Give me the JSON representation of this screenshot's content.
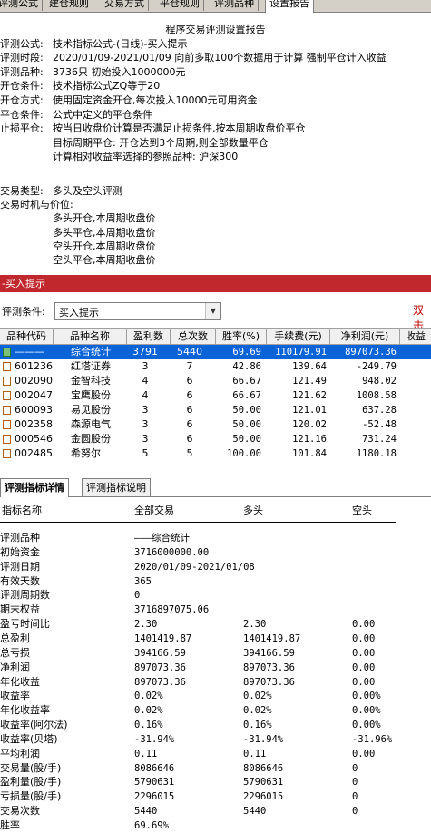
{
  "top_tabs": [
    "评测公式",
    "建仓规则",
    "交易方式",
    "平仓规则",
    "评测品种",
    "设置报告"
  ],
  "report": {
    "title": "程序交易评测设置报告",
    "lines": [
      {
        "label": "评测公式:",
        "value": "技术指标公式-(日线)-买入提示"
      },
      {
        "label": "评测时段:",
        "value": "2020/01/09-2021/01/09 向前多取100个数据用于计算 强制平仓计入收益"
      },
      {
        "label": "评测品种:",
        "value": "3736只 初始投入1000000元"
      },
      {
        "label": "开仓条件:",
        "value": "技术指标公式ZQ等于20"
      },
      {
        "label": "开仓方式:",
        "value": "使用固定资金开仓,每次投入10000元可用资金"
      },
      {
        "label": "平仓条件:",
        "value": "公式中定义的平仓条件"
      },
      {
        "label": "止损平仓:",
        "value": "按当日收盘价计算是否满足止损条件,按本周期收盘价平仓"
      },
      {
        "label": "",
        "value": "目标周期平仓: 开仓达到3个周期,则全部数量平仓"
      },
      {
        "label": "",
        "value": "计算相对收益率选择的参照品种: 沪深300"
      },
      {
        "label": "",
        "value": ""
      },
      {
        "label": "交易类型:",
        "value": "多头及空头评测"
      },
      {
        "label": "交易时机与价位:",
        "value": ""
      },
      {
        "label": "",
        "value": "多头开仓,本周期收盘价"
      },
      {
        "label": "",
        "value": "多头平仓,本周期收盘价"
      },
      {
        "label": "",
        "value": "空头开仓,本周期收盘价"
      },
      {
        "label": "",
        "value": "空头平仓,本周期收盘价"
      }
    ]
  },
  "red_bar": "-买入提示",
  "condition": {
    "label": "评测条件:",
    "value": "买入提示",
    "right_label": "双击"
  },
  "grid": {
    "headers": [
      "品种代码",
      "品种名称",
      "盈利数",
      "总次数",
      "胜率(%)",
      "手续费(元)",
      "净利润(元)",
      "收益"
    ],
    "rows": [
      [
        "———",
        "综合统计",
        "3791",
        "5440",
        "69.69",
        "110179.91",
        "897073.36"
      ],
      [
        "601236",
        "红塔证券",
        "3",
        "7",
        "42.86",
        "139.64",
        "-249.79"
      ],
      [
        "002090",
        "金智科技",
        "4",
        "6",
        "66.67",
        "121.49",
        "948.02"
      ],
      [
        "002047",
        "宝鹰股份",
        "4",
        "6",
        "66.67",
        "121.62",
        "1008.58"
      ],
      [
        "600093",
        "易见股份",
        "3",
        "6",
        "50.00",
        "121.01",
        "637.28"
      ],
      [
        "002358",
        "森源电气",
        "3",
        "6",
        "50.00",
        "120.02",
        "-52.48"
      ],
      [
        "000546",
        "金圆股份",
        "3",
        "6",
        "50.00",
        "121.16",
        "731.24"
      ],
      [
        "002485",
        "希努尔",
        "5",
        "5",
        "100.00",
        "101.84",
        "1180.18"
      ]
    ]
  },
  "mid_tabs": [
    "评测指标详情",
    "评测指标说明"
  ],
  "detail": {
    "headers": [
      "指标名称",
      "全部交易",
      "多头",
      "空头"
    ],
    "rows": [
      [
        "评测品种",
        "———综合统计",
        "",
        ""
      ],
      [
        "初始资金",
        "3716000000.00",
        "",
        ""
      ],
      [
        "评测日期",
        "2020/01/09-2021/01/08",
        "",
        ""
      ],
      [
        "有效天数",
        "365",
        "",
        ""
      ],
      [
        "评测周期数",
        "0",
        "",
        ""
      ],
      [
        "期末权益",
        "3716897075.06",
        "",
        ""
      ],
      [
        "盈亏时间比",
        "2.30",
        "2.30",
        "0.00"
      ],
      [
        "总盈利",
        "1401419.87",
        "1401419.87",
        "0.00"
      ],
      [
        "总亏损",
        "394166.59",
        "394166.59",
        "0.00"
      ],
      [
        "净利润",
        "897073.36",
        "897073.36",
        "0.00"
      ],
      [
        "年化收益",
        "897073.36",
        "897073.36",
        "0.00"
      ],
      [
        "收益率",
        "0.02%",
        "0.02%",
        "0.00%"
      ],
      [
        "年化收益率",
        "0.02%",
        "0.02%",
        "0.00%"
      ],
      [
        "收益率(阿尔法)",
        "0.16%",
        "0.16%",
        "0.00%"
      ],
      [
        "收益率(贝塔)",
        "-31.94%",
        "-31.94%",
        "-31.96%"
      ],
      [
        "平均利润",
        "0.11",
        "0.11",
        "0.00"
      ],
      [
        "交易量(股/手)",
        "8086646",
        "8086646",
        "0"
      ],
      [
        "盈利量(股/手)",
        "5790631",
        "5790631",
        "0"
      ],
      [
        "亏损量(股/手)",
        "2296015",
        "2296015",
        "0"
      ],
      [
        "交易次数",
        "5440",
        "5440",
        "0"
      ],
      [
        "胜率",
        "69.69%",
        "",
        ""
      ]
    ]
  }
}
